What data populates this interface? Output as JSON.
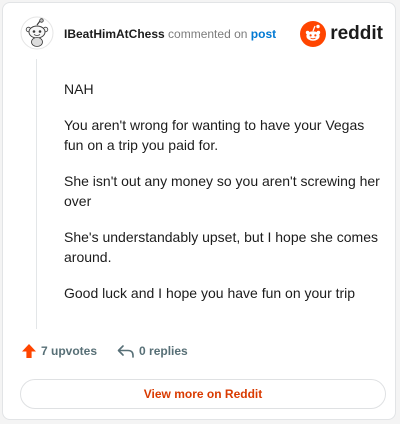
{
  "header": {
    "author": "IBeatHimAtChess",
    "action_text": "commented on",
    "post_link": "post",
    "brand": "reddit"
  },
  "comment": {
    "paragraphs": [
      "NAH",
      "You aren't wrong for wanting to have your Vegas fun on a trip you paid for.",
      "She isn't out any money so you aren't screwing her over",
      "She's understandably upset, but I hope she comes around.",
      "Good luck and I hope you have fun on your trip"
    ]
  },
  "footer": {
    "upvotes": "7 upvotes",
    "replies": "0 replies"
  },
  "cta": {
    "view_more": "View more on Reddit"
  },
  "colors": {
    "upvote": "#ff4500",
    "brand": "#ff4500",
    "link": "#0079d3",
    "cta": "#d93a00"
  },
  "icons": {
    "avatar": "snoo-avatar-icon",
    "logo": "reddit-logo-icon",
    "upvote": "upvote-arrow-icon",
    "reply": "reply-arrow-icon"
  }
}
